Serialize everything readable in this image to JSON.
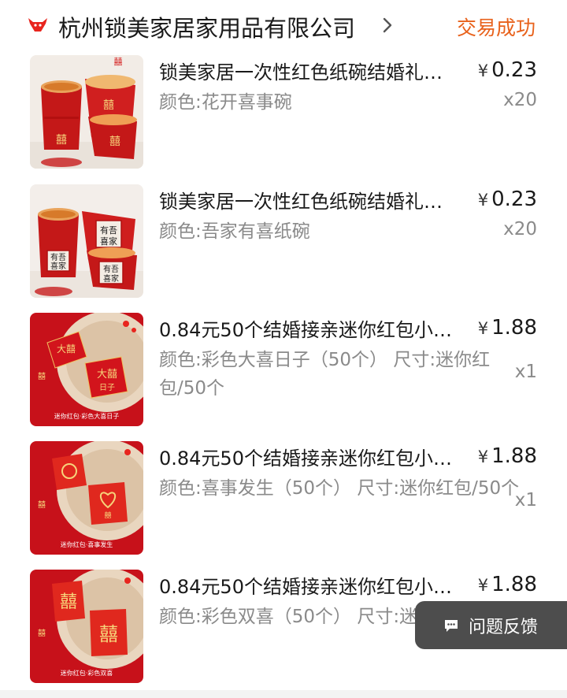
{
  "header": {
    "shop_name": "杭州锁美家居家用品有限公司",
    "status": "交易成功",
    "accent_color": "#e8621c",
    "shop_icon": "bull-shop-icon",
    "chevron_icon": "chevron-right-icon"
  },
  "items": [
    {
      "title": "锁美家居一次性红色纸碗结婚礼…",
      "spec": "颜色:花开喜事碗",
      "price_symbol": "¥",
      "price_value": "0.23",
      "quantity": "x20",
      "image_caption": ""
    },
    {
      "title": "锁美家居一次性红色纸碗结婚礼…",
      "spec": "颜色:吾家有喜纸碗",
      "price_symbol": "¥",
      "price_value": "0.23",
      "quantity": "x20",
      "image_caption": ""
    },
    {
      "title": "0.84元50个结婚接亲迷你红包小…",
      "spec": "颜色:彩色大喜日子（50个） 尺寸:迷你红包/50个",
      "price_symbol": "¥",
      "price_value": "1.88",
      "quantity": "x1",
      "image_caption": "迷你红包·彩色大喜日子"
    },
    {
      "title": "0.84元50个结婚接亲迷你红包小…",
      "spec": "颜色:喜事发生（50个） 尺寸:迷你红包/50个",
      "price_symbol": "¥",
      "price_value": "1.88",
      "quantity": "x1",
      "image_caption": "迷你红包·喜事发生"
    },
    {
      "title": "0.84元50个结婚接亲迷你红包小…",
      "spec": "颜色:彩色双喜（50个） 尺寸:迷你红包/50个",
      "price_symbol": "¥",
      "price_value": "1.88",
      "quantity": "",
      "image_caption": "迷你红包·彩色双喜"
    }
  ],
  "feedback": {
    "label": "问题反馈",
    "icon": "chat-bubble-icon"
  }
}
